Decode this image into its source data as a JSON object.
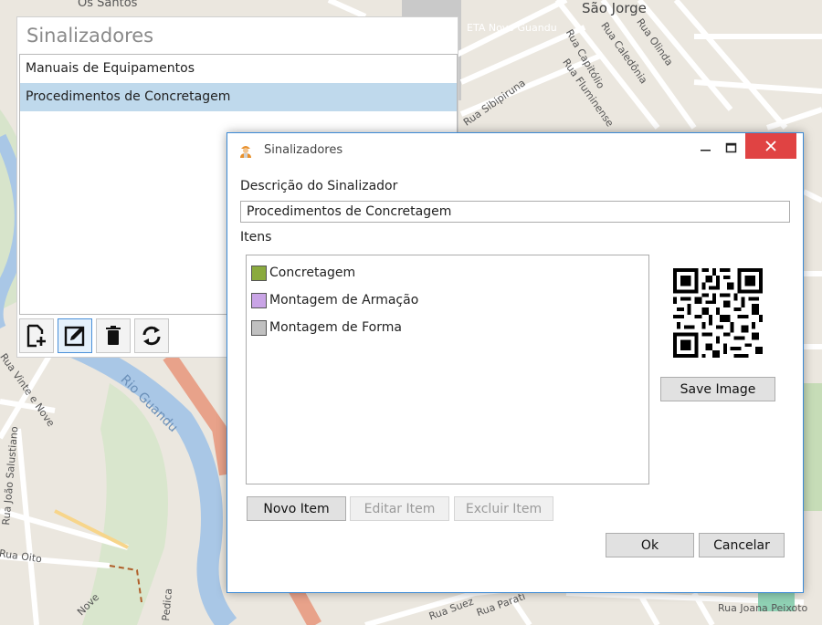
{
  "map": {
    "labels": [
      "Os Santos",
      "São Jorge",
      "ETA Novo Guandu",
      "Rua Capitólio",
      "Rua Caledônia",
      "Rua Olinda",
      "Rua Sibipiruna",
      "Rua Fluminense",
      "Rio Guandu",
      "Rua Vinte e Nove",
      "Rua João Salustiano",
      "Rua Oito",
      "Rua Suez",
      "Rua Parati",
      "Rua Joana Peixoto",
      "Nove",
      "Pedica"
    ]
  },
  "bg_panel": {
    "title": "Sinalizadores",
    "items": [
      {
        "label": "Manuais de Equipamentos",
        "selected": false
      },
      {
        "label": "Procedimentos de Concretagem",
        "selected": true
      }
    ],
    "toolbar": [
      "add-document-icon",
      "edit-icon",
      "trash-icon",
      "refresh-icon"
    ]
  },
  "dialog": {
    "title": "Sinalizadores",
    "description_label": "Descrição do Sinalizador",
    "description_value": "Procedimentos de Concretagem",
    "items_label": "Itens",
    "items": [
      {
        "label": "Concretagem",
        "color": "#8aaa3e"
      },
      {
        "label": "Montagem de Armação",
        "color": "#c9a4e6"
      },
      {
        "label": "Montagem de Forma",
        "color": "#c0c0c0"
      }
    ],
    "save_image": "Save Image",
    "new_item": "Novo Item",
    "edit_item": "Editar Item",
    "delete_item": "Excluir Item",
    "ok": "Ok",
    "cancel": "Cancelar"
  },
  "colors": {
    "accent": "#3c8ad6",
    "close": "#e04343",
    "selection": "#bfd9ec"
  }
}
